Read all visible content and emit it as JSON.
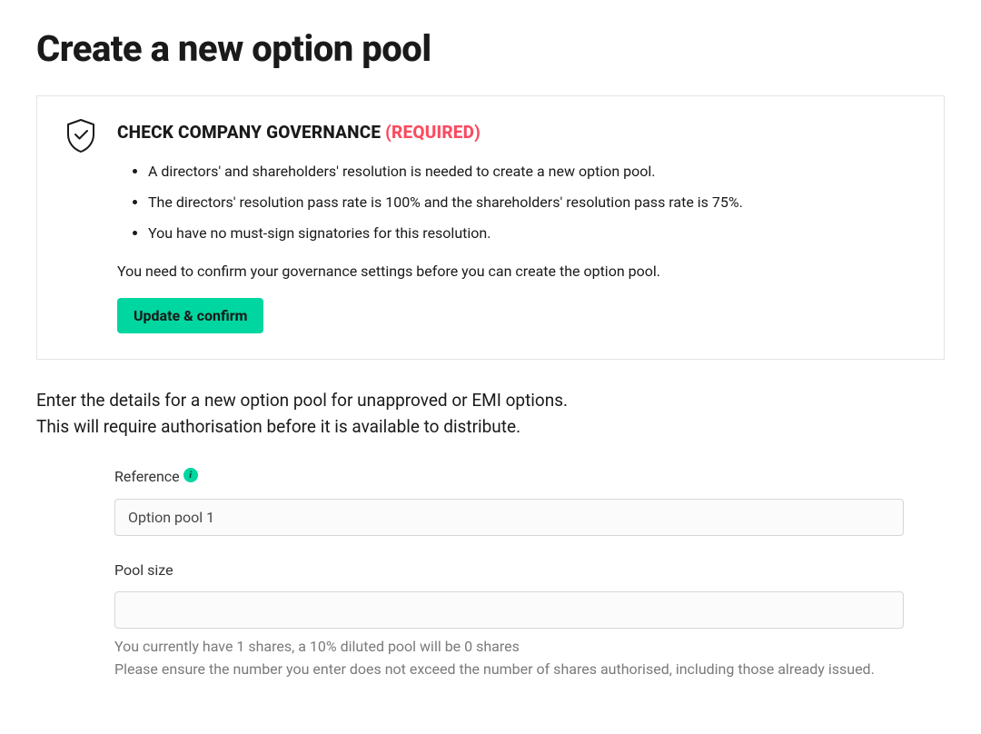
{
  "page": {
    "title": "Create a new option pool"
  },
  "governance": {
    "heading": "CHECK COMPANY GOVERNANCE",
    "required_label": "(REQUIRED)",
    "bullets": [
      "A directors' and shareholders' resolution is needed to create a new option pool.",
      "The directors' resolution pass rate is 100% and the shareholders' resolution pass rate is 75%.",
      "You have no must-sign signatories for this resolution."
    ],
    "confirm_text": "You need to confirm your governance settings before you can create the option pool.",
    "button_label": "Update & confirm"
  },
  "intro": {
    "line1": "Enter the details for a new option pool for unapproved or EMI options.",
    "line2": "This will require authorisation before it is available to distribute."
  },
  "form": {
    "reference": {
      "label": "Reference",
      "value": "Option pool 1",
      "info_icon": "i"
    },
    "pool_size": {
      "label": "Pool size",
      "value": "",
      "help_line1": "You currently have 1 shares, a 10% diluted pool will be 0 shares",
      "help_line2": "Please ensure the number you enter does not exceed the number of shares authorised, including those already issued."
    }
  }
}
